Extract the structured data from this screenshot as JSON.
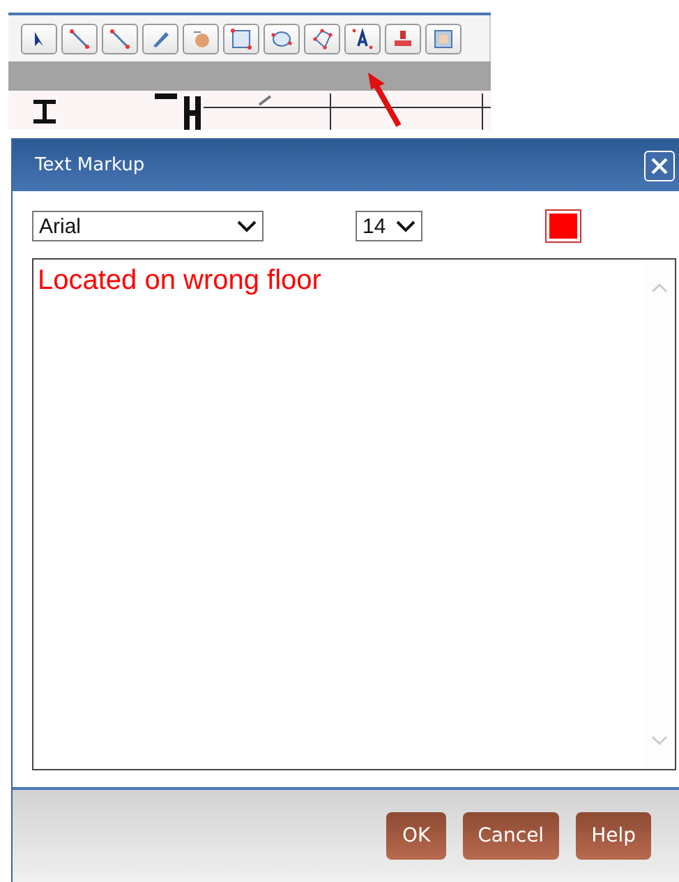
{
  "dialog": {
    "title": "Text Markup",
    "font": "Arial",
    "size": "14",
    "color": "#ff0000",
    "text": "Located on wrong floor"
  },
  "buttons": [
    "OK",
    "Cancel",
    "Help"
  ]
}
